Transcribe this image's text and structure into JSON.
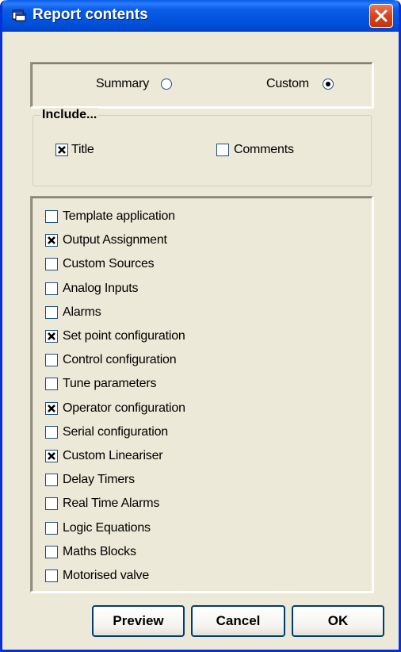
{
  "window": {
    "title": "Report contents",
    "accent": "#0a5ee5",
    "close_color": "#d8431a"
  },
  "mode": {
    "options": [
      {
        "label": "Summary",
        "selected": false
      },
      {
        "label": "Custom",
        "selected": true
      }
    ]
  },
  "include": {
    "legend": "Include...",
    "options": [
      {
        "label": "Title",
        "checked": true
      },
      {
        "label": "Comments",
        "checked": false
      }
    ]
  },
  "sections": [
    {
      "label": "Template application",
      "checked": false
    },
    {
      "label": "Output Assignment",
      "checked": true
    },
    {
      "label": "Custom Sources",
      "checked": false
    },
    {
      "label": "Analog Inputs",
      "checked": false
    },
    {
      "label": "Alarms",
      "checked": false
    },
    {
      "label": "Set point configuration",
      "checked": true
    },
    {
      "label": "Control configuration",
      "checked": false
    },
    {
      "label": "Tune parameters",
      "checked": false
    },
    {
      "label": "Operator configuration",
      "checked": true
    },
    {
      "label": "Serial configuration",
      "checked": false
    },
    {
      "label": "Custom Lineariser",
      "checked": true
    },
    {
      "label": "Delay Timers",
      "checked": false
    },
    {
      "label": "Real Time Alarms",
      "checked": false
    },
    {
      "label": "Logic Equations",
      "checked": false
    },
    {
      "label": "Maths Blocks",
      "checked": false
    },
    {
      "label": "Motorised valve",
      "checked": false
    }
  ],
  "buttons": {
    "preview": "Preview",
    "cancel": "Cancel",
    "ok": "OK"
  }
}
